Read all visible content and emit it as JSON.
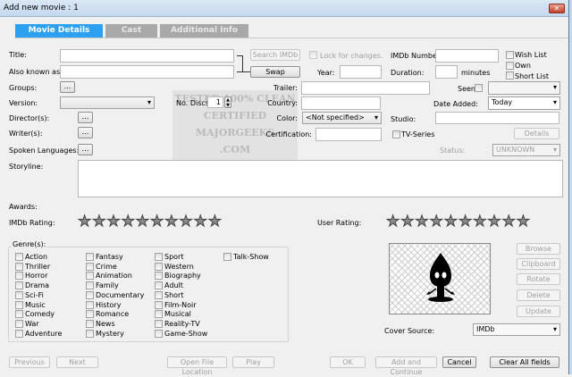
{
  "window": {
    "title": "Add new movie : 1",
    "close": "✕"
  },
  "tabs": [
    {
      "label": "Movie Details"
    },
    {
      "label": "Cast"
    },
    {
      "label": "Additional Info"
    }
  ],
  "watermark": [
    "TESTED 100% CLEAN",
    "CERTIFIED",
    "MAJORGEEKS",
    ".COM"
  ],
  "labels": {
    "title": "Title:",
    "aka": "Also known as:",
    "groups": "Groups:",
    "version": "Version:",
    "directors": "Director(s):",
    "writers": "Writer(s):",
    "languages": "Spoken Languages:",
    "storyline": "Storyline:",
    "awards": "Awards:",
    "imdb_rating": "IMDb Rating:",
    "user_rating": "User Rating:",
    "genres": "Genre(s):",
    "no_discs": "No. Discs:",
    "trailer": "Trailer:",
    "country": "Country:",
    "color": "Color:",
    "certification": "Certification:",
    "year": "Year:",
    "duration": "Duration:",
    "minutes": "minutes",
    "imdb_number": "IMDb Number:",
    "seen": "Seen",
    "date_added": "Date Added:",
    "studio": "Studio:",
    "status": "Status:",
    "cover_source": "Cover Source:",
    "lock": "Lock for changes.",
    "tv_series": "TV-Series",
    "wish_list": "Wish List",
    "own": "Own",
    "short_list": "Short List"
  },
  "values": {
    "no_discs": "1",
    "color": "<Not specified>",
    "date_added": "Today",
    "status": "UNKNOWN",
    "cover_source": "IMDb",
    "dots": "..."
  },
  "buttons": {
    "search_imdb": "Search IMDb",
    "swap": "Swap",
    "details": "Details",
    "browse": "Browse",
    "clipboard": "Clipboard",
    "rotate": "Rotate",
    "delete": "Delete",
    "update": "Update",
    "previous": "Previous",
    "next": "Next",
    "open_file": "Open File Location",
    "play": "Play",
    "ok": "OK",
    "add_continue": "Add and Continue",
    "cancel": "Cancel",
    "clear": "Clear All fields"
  },
  "ratings": {
    "imdb": 0,
    "user": 0,
    "max": 10
  },
  "genres": [
    [
      "Action",
      "Thriller",
      "Horror",
      "Drama",
      "Sci-Fi",
      "Music",
      "Comedy",
      "War",
      "Adventure"
    ],
    [
      "Fantasy",
      "Crime",
      "Animation",
      "Family",
      "Documentary",
      "History",
      "Romance",
      "News",
      "Mystery"
    ],
    [
      "Sport",
      "Western",
      "Biography",
      "Adult",
      "Short",
      "Film-Noir",
      "Musical",
      "Reality-TV",
      "Game-Show"
    ],
    [
      "Talk-Show"
    ]
  ]
}
